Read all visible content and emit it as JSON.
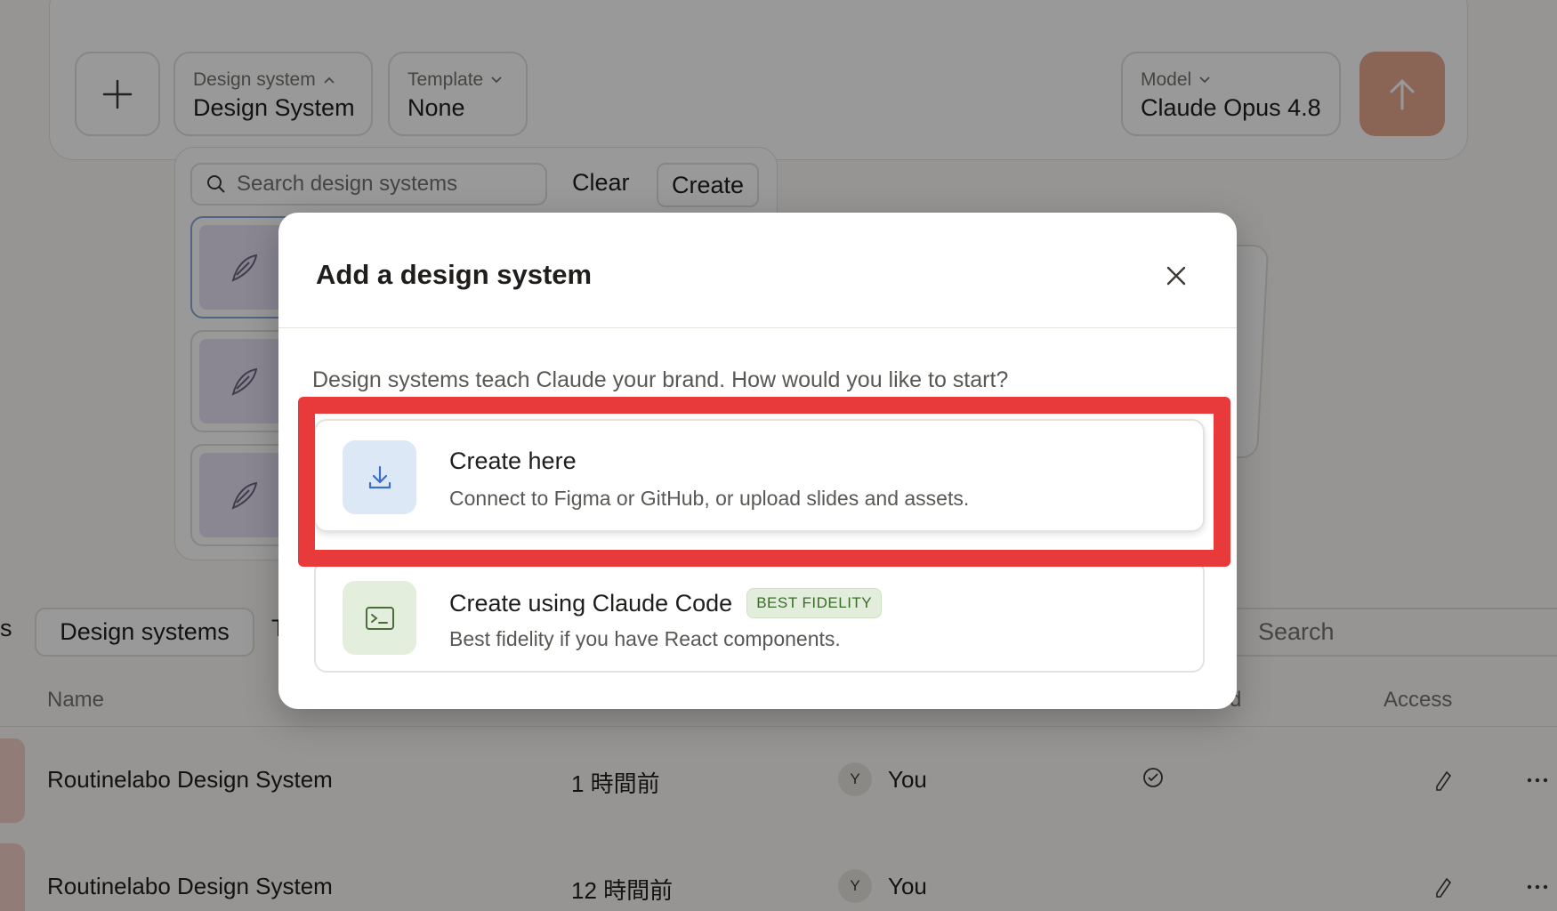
{
  "composer": {
    "design_system_label": "Design system",
    "design_system_value": "Design System",
    "template_label": "Template",
    "template_value": "None",
    "model_label": "Model",
    "model_value": "Claude Opus 4.8"
  },
  "dropdown": {
    "search_placeholder": "Search design systems",
    "clear_label": "Clear",
    "create_label": "Create"
  },
  "tabs": {
    "left_fragment": "s",
    "active": "Design systems",
    "next_fragment": "T",
    "search_placeholder": "Search"
  },
  "table": {
    "headers": {
      "name": "Name",
      "status_fragment": "d",
      "access": "Access"
    },
    "rows": [
      {
        "name": "Routinelabo Design System",
        "updated": "1 時間前",
        "owner_initial": "Y",
        "owner": "You"
      },
      {
        "name": "Routinelabo Design System",
        "updated": "12 時間前",
        "owner_initial": "Y",
        "owner": "You"
      }
    ]
  },
  "modal": {
    "title": "Add a design system",
    "description": "Design systems teach Claude your brand. How would you like to start?",
    "options": [
      {
        "title": "Create here",
        "subtitle": "Connect to Figma or GitHub, or upload slides and assets.",
        "icon": "download-icon"
      },
      {
        "title": "Create using Claude Code",
        "badge": "BEST FIDELITY",
        "subtitle": "Best fidelity if you have React components.",
        "icon": "terminal-icon"
      }
    ]
  },
  "colors": {
    "highlight": "#e83a3a",
    "send_button": "#e7a78d",
    "option1_icon_bg": "#dde8f7",
    "option2_icon_bg": "#e4eedd",
    "badge_text": "#3b6b2a"
  }
}
